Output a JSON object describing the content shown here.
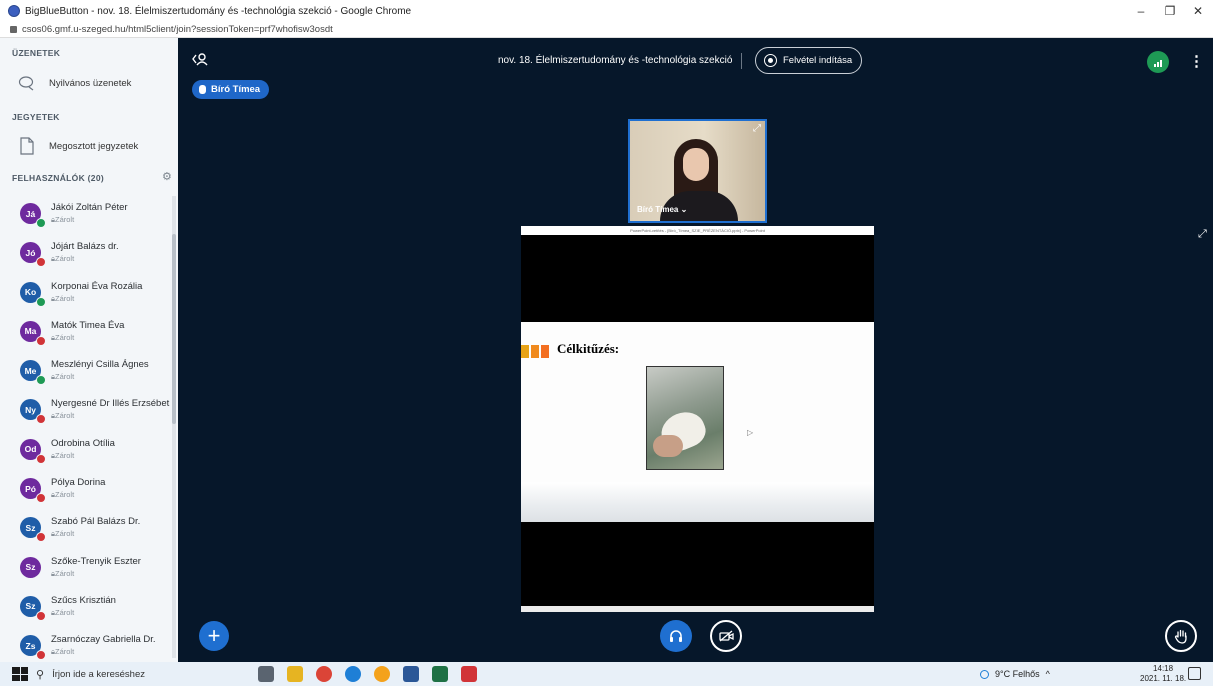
{
  "browser": {
    "window_title": "BigBlueButton - nov. 18. Élelmiszertudomány és -technológia szekció - Google Chrome",
    "url": "csos06.gmf.u-szeged.hu/html5client/join?sessionToken=prf7whofisw3osdt",
    "controls": {
      "minimize": "–",
      "restore": "❐",
      "close": "✕"
    }
  },
  "sidebar": {
    "messages_title": "ÜZENETEK",
    "public_chat": "Nyilvános üzenetek",
    "notes_title": "JEGYETEK",
    "shared_notes": "Megosztott jegyzetek",
    "users_title": "FELHASZNÁLÓK (20)",
    "users": [
      {
        "initials": "Já",
        "name": "Jákói Zoltán Péter",
        "status": "Zárolt",
        "color": "#6e2a9e",
        "mic": "listen"
      },
      {
        "initials": "Jó",
        "name": "Jójárt Balázs dr.",
        "status": "Zárolt",
        "color": "#6e2a9e",
        "mic": "muted"
      },
      {
        "initials": "Ko",
        "name": "Korponai Éva Rozália",
        "status": "Zárolt",
        "color": "#1f5da8",
        "mic": "listen"
      },
      {
        "initials": "Ma",
        "name": "Matók Timea Éva",
        "status": "Zárolt",
        "color": "#6e2a9e",
        "mic": "muted"
      },
      {
        "initials": "Me",
        "name": "Meszlényi Csilla Ágnes",
        "status": "Zárolt",
        "color": "#1f5da8",
        "mic": "listen"
      },
      {
        "initials": "Ny",
        "name": "Nyergesné Dr Illés Erzsébet",
        "status": "Zárolt",
        "color": "#1f5da8",
        "mic": "muted"
      },
      {
        "initials": "Od",
        "name": "Odrobina Otília",
        "status": "Zárolt",
        "color": "#6e2a9e",
        "mic": "muted"
      },
      {
        "initials": "Pó",
        "name": "Pólya Dorina",
        "status": "Zárolt",
        "color": "#6e2a9e",
        "mic": "muted"
      },
      {
        "initials": "Sz",
        "name": "Szabó Pál Balázs Dr.",
        "status": "Zárolt",
        "color": "#1f5da8",
        "mic": "muted"
      },
      {
        "initials": "Sz",
        "name": "Szőke-Trenyik Eszter",
        "status": "Zárolt",
        "color": "#6e2a9e",
        "mic": "none"
      },
      {
        "initials": "Sz",
        "name": "Szűcs Krisztián",
        "status": "Zárolt",
        "color": "#1f5da8",
        "mic": "muted"
      },
      {
        "initials": "Zs",
        "name": "Zsarnóczay Gabriella Dr.",
        "status": "Zárolt",
        "color": "#1f5da8",
        "mic": "muted"
      }
    ],
    "mic_colors": {
      "listen": "#1e9a55",
      "muted": "#d13438"
    }
  },
  "main": {
    "meeting_title": "nov. 18. Élelmiszertudomány és -technológia szekció",
    "record_label": "Felvétel indítása",
    "talker": "Bíró Tímea",
    "webcam_name": "Bíró Tímea",
    "webcam_suffix": "⌄",
    "screenshare": {
      "window_title": "PowerPoint-vetítés - [Bíró_Tímea_SZIE_PRÉZENTÁCIÓ.pptx] - PowerPoint",
      "slide_heading": "Célkitűzés:",
      "bar_colors": [
        "#e8a317",
        "#f08a1e",
        "#f36f21"
      ]
    },
    "accent": "#1f6fd0"
  },
  "taskbar": {
    "search_placeholder": "Írjon ide a kereséshez",
    "weather": "9°C Felhős",
    "time": "14:18",
    "date": "2021. 11. 18."
  }
}
